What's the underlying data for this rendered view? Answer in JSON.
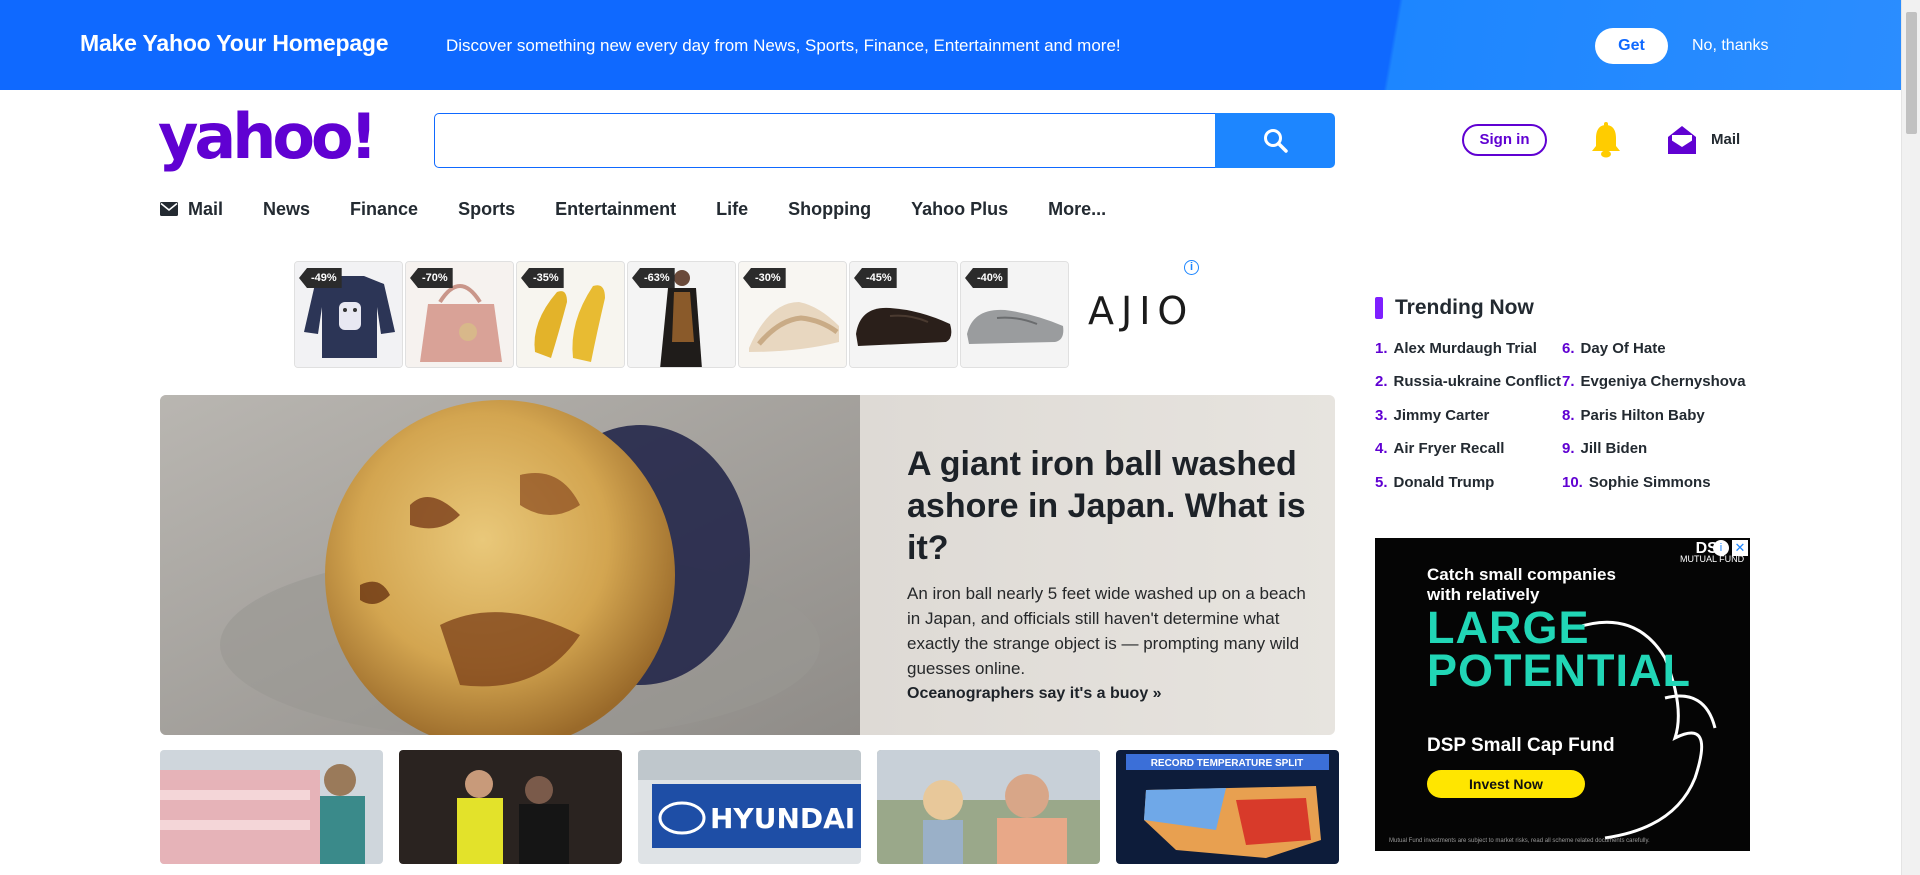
{
  "promo": {
    "title": "Make Yahoo Your Homepage",
    "subtitle": "Discover something new every day from News, Sports, Finance, Entertainment and more!",
    "get_label": "Get",
    "decline_label": "No, thanks"
  },
  "header": {
    "logo_text": "yahoo!",
    "search_value": "",
    "signin_label": "Sign in",
    "mail_label": "Mail"
  },
  "nav": {
    "items": [
      {
        "label": "Mail"
      },
      {
        "label": "News"
      },
      {
        "label": "Finance"
      },
      {
        "label": "Sports"
      },
      {
        "label": "Entertainment"
      },
      {
        "label": "Life"
      },
      {
        "label": "Shopping"
      },
      {
        "label": "Yahoo Plus"
      },
      {
        "label": "More..."
      }
    ]
  },
  "adstrip": {
    "brand": "AJIO",
    "items": [
      {
        "discount": "-49%",
        "product": "sweatshirt"
      },
      {
        "discount": "-70%",
        "product": "handbag"
      },
      {
        "discount": "-35%",
        "product": "yellow flats"
      },
      {
        "discount": "-63%",
        "product": "saree"
      },
      {
        "discount": "-30%",
        "product": "sandals"
      },
      {
        "discount": "-45%",
        "product": "loafers"
      },
      {
        "discount": "-40%",
        "product": "grey shoes"
      }
    ]
  },
  "hero": {
    "title": "A giant iron ball washed ashore in Japan. What is it?",
    "summary": "An iron ball nearly 5 feet wide washed up on a beach in Japan, and officials still haven't determine what exactly the strange object is — prompting many wild guesses online.",
    "link": "Oceanographers say it's a buoy »"
  },
  "thumbs": [
    {
      "subject": "grocery meat aisle"
    },
    {
      "subject": "soccer referee"
    },
    {
      "subject": "hyundai sign",
      "text": "HYUNDAI"
    },
    {
      "subject": "child and man"
    },
    {
      "subject": "temperature map",
      "text": "RECORD TEMPERATURE SPLIT"
    }
  ],
  "trending": {
    "title": "Trending Now",
    "items": [
      {
        "num": "1.",
        "label": "Alex Murdaugh Trial"
      },
      {
        "num": "2.",
        "label": "Russia-ukraine Conflict"
      },
      {
        "num": "3.",
        "label": "Jimmy Carter"
      },
      {
        "num": "4.",
        "label": "Air Fryer Recall"
      },
      {
        "num": "5.",
        "label": "Donald Trump"
      },
      {
        "num": "6.",
        "label": "Day Of Hate"
      },
      {
        "num": "7.",
        "label": "Evgeniya Chernyshova"
      },
      {
        "num": "8.",
        "label": "Paris Hilton Baby"
      },
      {
        "num": "9.",
        "label": "Jill Biden"
      },
      {
        "num": "10.",
        "label": "Sophie Simmons"
      }
    ]
  },
  "side_ad": {
    "line1": "Catch small companies",
    "line2": "with relatively",
    "big1": "LARGE",
    "big2": "POTENTIAL",
    "fund": "DSP Small Cap Fund",
    "cta": "Invest Now",
    "logo": "DSP",
    "logo_sub": "MUTUAL FUND",
    "disclaimer": "Mutual Fund investments are subject to market risks, read all scheme related documents carefully."
  },
  "colors": {
    "brand_purple": "#6001d2",
    "promo_blue": "#0f69ff",
    "search_blue": "#1d86ff",
    "bell_yellow": "#ffcc00",
    "ad_teal": "#21d6b6",
    "ad_yellow": "#ffe600"
  },
  "icons": [
    "search-icon",
    "bell-icon",
    "mail-icon",
    "info-icon",
    "close-icon"
  ]
}
